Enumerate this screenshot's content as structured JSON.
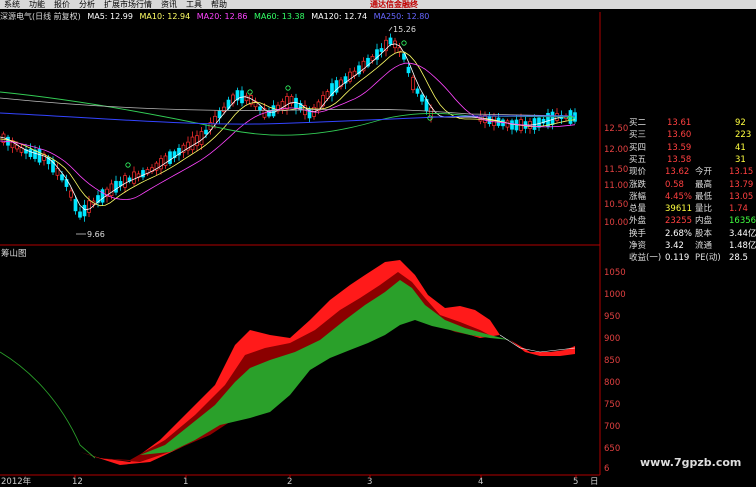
{
  "menu": {
    "items": [
      "系统",
      "功能",
      "报价",
      "分析",
      "扩展市场行情",
      "资讯",
      "工具",
      "帮助"
    ],
    "promo": "通达信金融终"
  },
  "ma_line": {
    "name": "深源电气(日线 前复权)",
    "items": [
      {
        "label": "MA5: 12.99",
        "color": "#ffffff"
      },
      {
        "label": "MA10: 12.94",
        "color": "#ffff66"
      },
      {
        "label": "MA20: 12.86",
        "color": "#ff44ff"
      },
      {
        "label": "MA60: 13.38",
        "color": "#33ff66"
      },
      {
        "label": "MA120: 12.74",
        "color": "#ffffff"
      },
      {
        "label": "MA250: 12.80",
        "color": "#6666ff"
      }
    ]
  },
  "price_panel": {
    "high_label": "15.26",
    "low_label": "9.66",
    "ticks": [
      "12.50",
      "12.00",
      "11.50",
      "11.00",
      "10.50",
      "10.00"
    ],
    "label_color": "#e04040"
  },
  "indicator_panel": {
    "title": "筹山图",
    "ticks": [
      "1050",
      "1000",
      "950",
      "900",
      "850",
      "800",
      "750",
      "700",
      "650",
      "6"
    ]
  },
  "x_axis": {
    "labels": [
      "2012年",
      "12",
      "1",
      "2",
      "3",
      "4",
      "5",
      "日"
    ]
  },
  "quote": {
    "bids": [
      {
        "label": "买二",
        "price": "13.61",
        "vol": "92"
      },
      {
        "label": "买三",
        "price": "13.60",
        "vol": "223"
      },
      {
        "label": "买四",
        "price": "13.59",
        "vol": "41"
      },
      {
        "label": "买五",
        "price": "13.58",
        "vol": "31"
      }
    ],
    "rows": [
      {
        "l1": "现价",
        "v1": "13.62",
        "c1": "#ff4040",
        "l2": "今开",
        "v2": "13.15",
        "c2": "#ff4040"
      },
      {
        "l1": "涨跌",
        "v1": "0.58",
        "c1": "#ff4040",
        "l2": "最高",
        "v2": "13.79",
        "c2": "#ff4040"
      },
      {
        "l1": "涨幅",
        "v1": "4.45%",
        "c1": "#ff4040",
        "l2": "最低",
        "v2": "13.05",
        "c2": "#ff4040"
      },
      {
        "l1": "总量",
        "v1": "39611",
        "c1": "#ffff40",
        "l2": "量比",
        "v2": "1.74",
        "c2": "#ff4040"
      },
      {
        "l1": "外盘",
        "v1": "23255",
        "c1": "#ff4040",
        "l2": "内盘",
        "v2": "16356",
        "c2": "#40ff40"
      },
      {
        "l1": "换手",
        "v1": "2.68%",
        "c1": "#ffffff",
        "l2": "股本",
        "v2": "3.44亿",
        "c2": "#ffffff"
      },
      {
        "l1": "净资",
        "v1": "3.42",
        "c1": "#ffffff",
        "l2": "流通",
        "v2": "1.48亿",
        "c2": "#ffffff"
      },
      {
        "l1": "收益(一)",
        "v1": "0.119",
        "c1": "#ffffff",
        "l2": "PE(动)",
        "v2": "28.5",
        "c2": "#ffffff"
      }
    ]
  },
  "watermark": "www.7gpzb.com",
  "colors": {
    "up": "#ff3030",
    "down": "#00e5ff",
    "band_red": "#ff1a1a",
    "band_dark": "#8b0000",
    "band_green": "#2aa02a"
  }
}
